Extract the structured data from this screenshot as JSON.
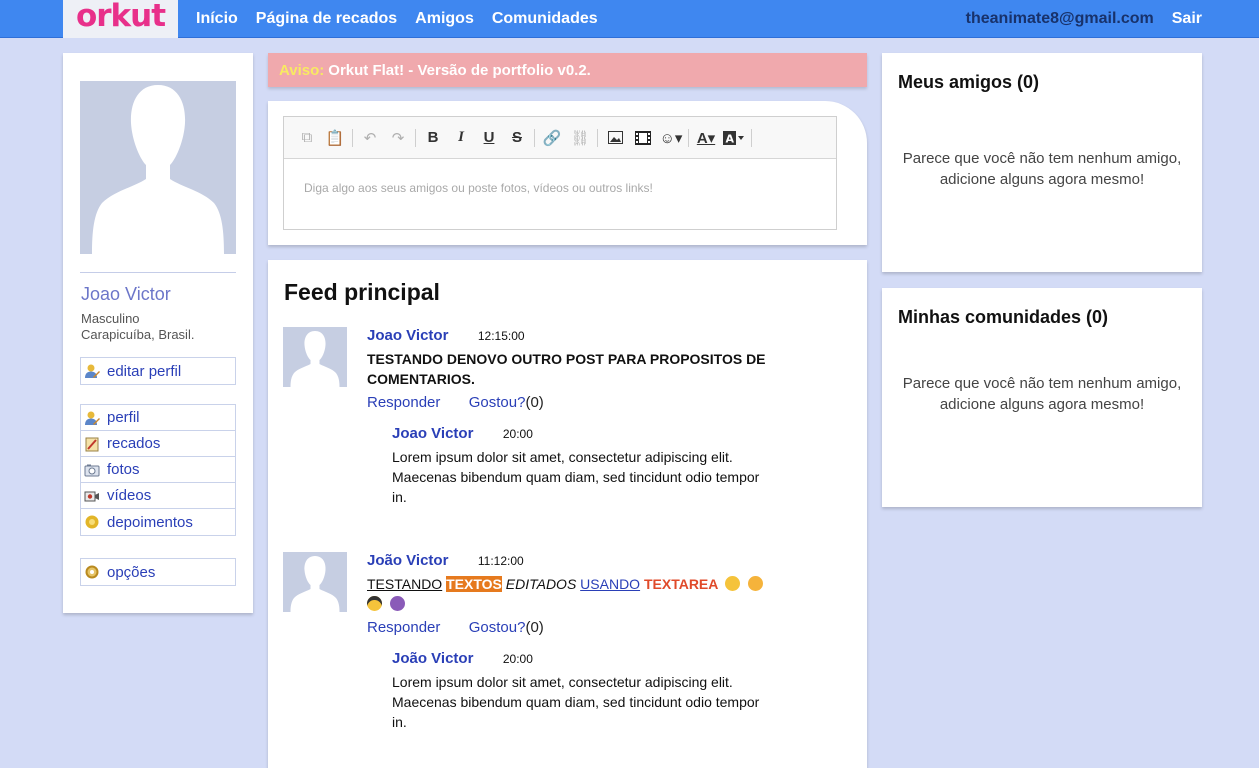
{
  "brand": {
    "logo": "orkut"
  },
  "nav": {
    "items": [
      "Início",
      "Página de recados",
      "Amigos",
      "Comunidades"
    ],
    "email": "theanimate8@gmail.com",
    "logout": "Sair"
  },
  "profile": {
    "name": "Joao Victor",
    "gender": "Masculino",
    "location": "Carapicuíba, Brasil.",
    "edit_label": "editar perfil",
    "menu": [
      "perfil",
      "recados",
      "fotos",
      "vídeos",
      "depoimentos"
    ],
    "options_label": "opções"
  },
  "notice": {
    "label": "Aviso:",
    "text": "Orkut Flat! - Versão de portfolio v0.2."
  },
  "composer": {
    "placeholder": "Diga algo aos seus amigos ou poste fotos, vídeos ou outros links!"
  },
  "feed": {
    "title": "Feed principal",
    "posts": [
      {
        "author": "Joao Victor",
        "time": "12:15:00",
        "text": "TESTANDO DENOVO OUTRO POST PARA PROPOSITOS DE COMENTARIOS.",
        "reply_label": "Responder",
        "like_label": "Gostou?",
        "like_count": "(0)",
        "comment": {
          "author": "Joao Victor",
          "time": "20:00",
          "text": "Lorem ipsum dolor sit amet, consectetur adipiscing elit. Maecenas bibendum quam diam, sed tincidunt odio tempor in."
        }
      },
      {
        "author": "João Victor",
        "time": "11:12:00",
        "rich": {
          "part1": "TESTANDO",
          "part2": "TEXTOS",
          "part3": "EDITADOS",
          "part4": "USANDO",
          "part5": "TEXTAREA"
        },
        "reply_label": "Responder",
        "like_label": "Gostou?",
        "like_count": "(0)",
        "comment": {
          "author": "João Victor",
          "time": "20:00",
          "text": "Lorem ipsum dolor sit amet, consectetur adipiscing elit. Maecenas bibendum quam diam, sed tincidunt odio tempor in."
        }
      }
    ]
  },
  "friends": {
    "title": "Meus amigos (0)",
    "empty": "Parece que você não tem nenhum amigo, adicione alguns agora mesmo!"
  },
  "communities": {
    "title": "Minhas comunidades (0)",
    "empty": "Parece que você não tem nenhum amigo, adicione alguns agora mesmo!"
  },
  "colors": {
    "topbar": "#3f87f0",
    "background": "#d3dbf6",
    "brand": "#e8308a",
    "link": "#2a3fb7",
    "notice": "#f0a9ad"
  }
}
